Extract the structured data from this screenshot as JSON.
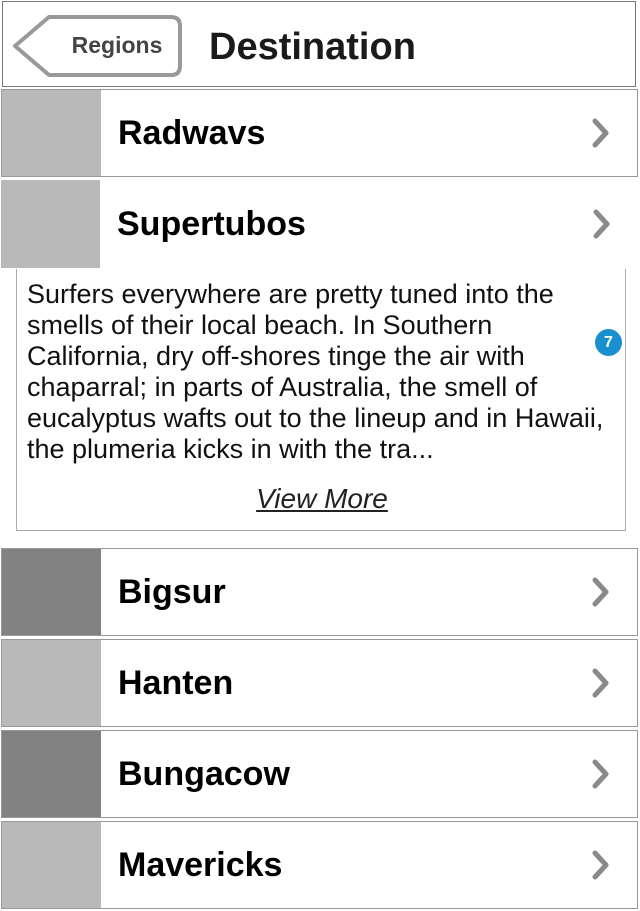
{
  "header": {
    "back_label": "Regions",
    "title": "Destination"
  },
  "destinations": [
    {
      "label": "Radwavs",
      "thumb_color": "#b9b9b9"
    },
    {
      "label": "Supertubos",
      "thumb_color": "#b9b9b9"
    },
    {
      "label": "Bigsur",
      "thumb_color": "#828282"
    },
    {
      "label": "Hanten",
      "thumb_color": "#b9b9b9"
    },
    {
      "label": "Bungacow",
      "thumb_color": "#828282"
    },
    {
      "label": "Mavericks",
      "thumb_color": "#b9b9b9"
    }
  ],
  "expanded": {
    "description": "Surfers everywhere are pretty tuned into the smells of their local beach. In Southern California, dry off-shores tinge the air with chaparral; in parts of Australia, the smell of eucalyptus wafts out to the lineup and in Hawaii, the plumeria kicks in with the tra...",
    "view_more_label": "View More"
  },
  "badge": {
    "count": "7",
    "color": "#1a8fd0"
  },
  "icons": {
    "back": "back-arrow-icon",
    "row_chevron": "chevron-right-icon"
  }
}
